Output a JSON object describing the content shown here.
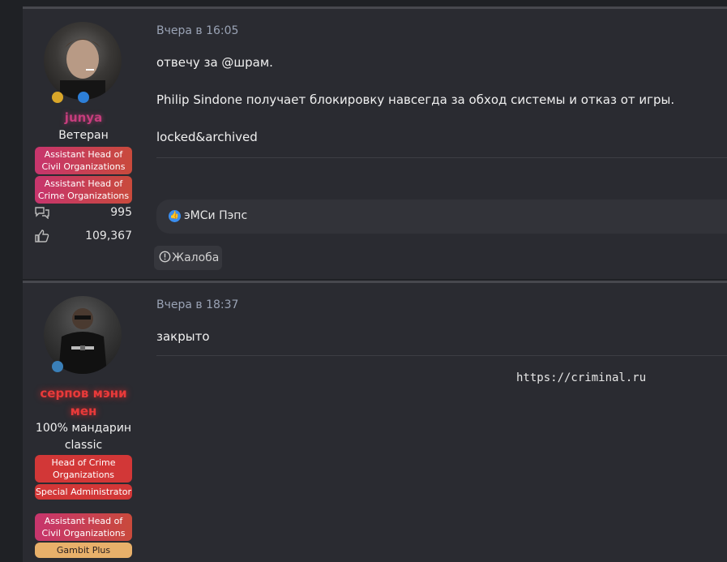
{
  "posts": [
    {
      "user": {
        "name": "junya",
        "title": "Ветеран",
        "groups": [
          "Assistant Head of Civil Organizations",
          "Assistant Head of Crime Organizations"
        ],
        "messages": "995",
        "reactions": "109,367"
      },
      "time": "Вчера в 16:05",
      "lines": [
        "отвечу за @шрам.",
        "Philip Sindone получает блокировку навсегда за обход системы и отказ от игры.",
        "locked&archived"
      ],
      "reaction_users": "эМСи Пэпс",
      "report_label": "Жалоба"
    },
    {
      "user": {
        "name": "серпов мэни мен",
        "title": "100% мандарин classic",
        "groups": [
          "Head of Crime Organizations",
          "Special Administrator",
          "Assistant Head of Civil Organizations",
          "Gambit Plus"
        ]
      },
      "time": "Вчера в 18:37",
      "lines": [
        "закрыто"
      ],
      "signature": "https://criminal.ru"
    }
  ],
  "icons": {
    "messages": "speech-bubbles-icon",
    "reactions": "thumbs-up-icon",
    "report": "info-circle-icon",
    "like": "like-icon"
  },
  "colors": {
    "page_bg": "#1f2125",
    "post_bg": "#2a2b31",
    "name1": "#c63d7d",
    "name2": "#e83a3a",
    "like": "#3a8ef0"
  }
}
